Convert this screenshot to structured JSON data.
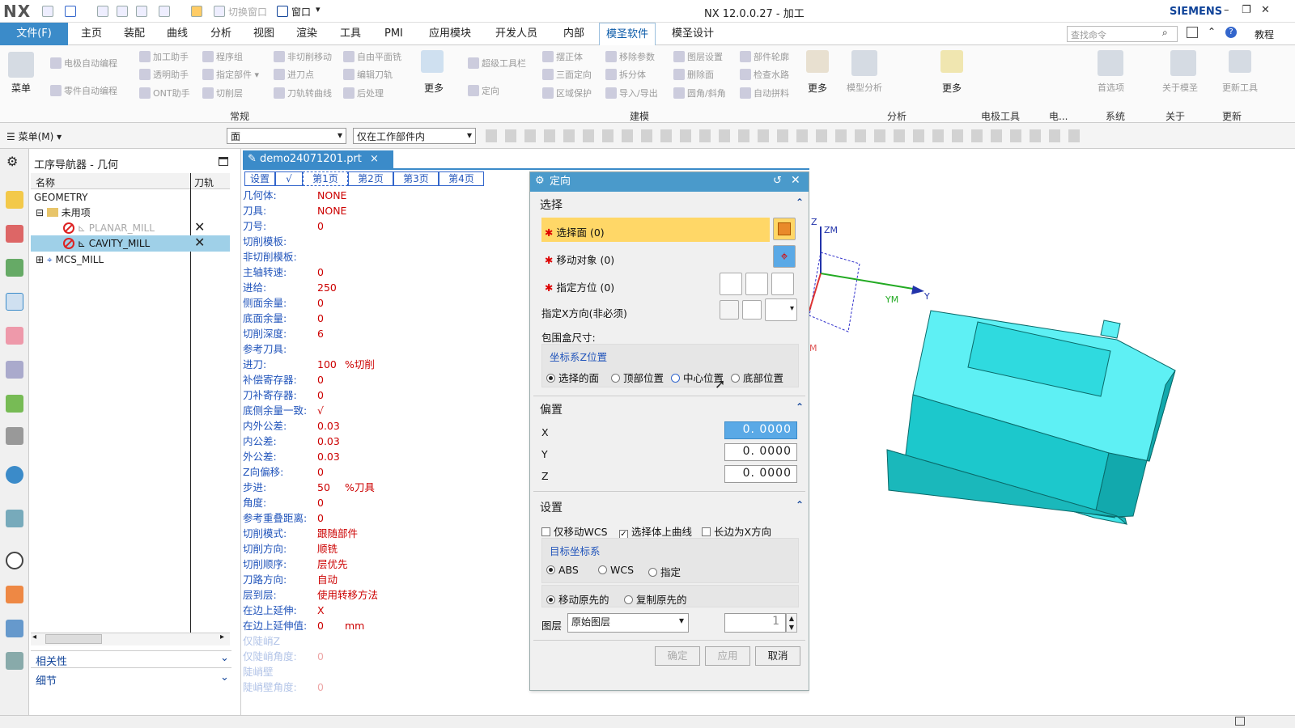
{
  "app": {
    "logo": "NX",
    "title": "NX 12.0.0.27 - 加工",
    "brand": "SIEMENS",
    "brand_color": "#1a4f9a",
    "accent": "#3b8bc9"
  },
  "quickaccess": {
    "switch_window": "切换窗口",
    "window": "窗口"
  },
  "menu": {
    "file": "文件(F)",
    "tabs": [
      "主页",
      "装配",
      "曲线",
      "分析",
      "视图",
      "渲染",
      "工具",
      "PMI",
      "应用模块",
      "开发人员",
      "内部",
      "模圣软件",
      "模圣设计"
    ],
    "active_tab": "模圣软件",
    "search_placeholder": "查找命令",
    "help": "教程"
  },
  "ribbon": {
    "menu_label": "菜单",
    "col1": [
      "电极自动编程",
      "零件自动编程"
    ],
    "col2": [
      "加工助手",
      "透明助手",
      "ONT助手"
    ],
    "col3": [
      "程序组",
      "指定部件",
      "切削层"
    ],
    "col4": [
      "非切削移动",
      "进刀点",
      "刀轨转曲线"
    ],
    "col5": [
      "自由平面铣",
      "编辑刀轨",
      "后处理"
    ],
    "more1": "更多",
    "col6": [
      "超级工具栏",
      "定向"
    ],
    "col7": [
      "摆正体",
      "三面定向",
      "区域保护"
    ],
    "col8": [
      "移除参数",
      "拆分体",
      "导入/导出"
    ],
    "col9": [
      "图层设置",
      "删除面",
      "圆角/斜角"
    ],
    "col10": [
      "部件轮廓",
      "检查水路",
      "自动拼料"
    ],
    "more2": "更多",
    "model_analysis": "模型分析",
    "more3": "更多",
    "prefs": "首选项",
    "about": "关于模圣",
    "update": "更新工具",
    "groups": [
      "常规",
      "建模",
      "分析",
      "电极工具",
      "电...",
      "系统",
      "关于",
      "更新"
    ]
  },
  "toolbar2": {
    "menu": "菜单(M)",
    "filter": "面",
    "scope": "仅在工作部件内"
  },
  "navigator": {
    "title": "工序导航器 - 几何",
    "col_name": "名称",
    "col_path": "刀轨",
    "rows": [
      {
        "name": "GEOMETRY"
      },
      {
        "name": "未用项"
      },
      {
        "name": "PLANAR_MILL"
      },
      {
        "name": "CAVITY_MILL"
      },
      {
        "name": "MCS_MILL"
      }
    ],
    "path_mark": "✕",
    "relations": "相关性",
    "details": "细节"
  },
  "document": {
    "tab": "demo24071201.prt",
    "close": "×"
  },
  "info": {
    "tabs": [
      "设置",
      "√",
      "第1页",
      "第2页",
      "第3页",
      "第4页"
    ],
    "rows": [
      {
        "label": "几何体:",
        "value": "NONE",
        "unit": ""
      },
      {
        "label": "刀具:",
        "value": "NONE",
        "unit": ""
      },
      {
        "label": "刀号:",
        "value": "0",
        "unit": ""
      },
      {
        "label": "切削模板:",
        "value": "",
        "unit": ""
      },
      {
        "label": "非切削模板:",
        "value": "",
        "unit": ""
      },
      {
        "label": "主轴转速:",
        "value": "0",
        "unit": ""
      },
      {
        "label": "进给:",
        "value": "250",
        "unit": ""
      },
      {
        "label": "侧面余量:",
        "value": "0",
        "unit": ""
      },
      {
        "label": "底面余量:",
        "value": "0",
        "unit": ""
      },
      {
        "label": "切削深度:",
        "value": "6",
        "unit": ""
      },
      {
        "label": "参考刀具:",
        "value": "",
        "unit": ""
      },
      {
        "label": "进刀:",
        "value": "100",
        "unit": "%切削"
      },
      {
        "label": "补偿寄存器:",
        "value": "0",
        "unit": ""
      },
      {
        "label": "刀补寄存器:",
        "value": "0",
        "unit": ""
      },
      {
        "label": "底侧余量一致:",
        "value": "√",
        "unit": ""
      },
      {
        "label": "内外公差:",
        "value": "0.03",
        "unit": ""
      },
      {
        "label": "内公差:",
        "value": "0.03",
        "unit": ""
      },
      {
        "label": "外公差:",
        "value": "0.03",
        "unit": ""
      },
      {
        "label": "Z向偏移:",
        "value": "0",
        "unit": ""
      },
      {
        "label": "步进:",
        "value": "50",
        "unit": "%刀具"
      },
      {
        "label": "角度:",
        "value": "0",
        "unit": ""
      },
      {
        "label": "参考重叠距离:",
        "value": "0",
        "unit": ""
      },
      {
        "label": "切削模式:",
        "value": "跟随部件",
        "unit": ""
      },
      {
        "label": "切削方向:",
        "value": "顺铣",
        "unit": ""
      },
      {
        "label": "切削顺序:",
        "value": "层优先",
        "unit": ""
      },
      {
        "label": "刀路方向:",
        "value": "自动",
        "unit": ""
      },
      {
        "label": "层到层:",
        "value": "使用转移方法",
        "unit": ""
      },
      {
        "label": "在边上延伸:",
        "value": "X",
        "unit": ""
      },
      {
        "label": "在边上延伸值:",
        "value": "0",
        "unit": "mm"
      },
      {
        "label": "仅陡峭Z",
        "value": "",
        "unit": ""
      },
      {
        "label": "仅陡峭角度:",
        "value": "0",
        "unit": ""
      },
      {
        "label": "陡峭壁",
        "value": "",
        "unit": ""
      },
      {
        "label": "陡峭壁角度:",
        "value": "0",
        "unit": ""
      }
    ]
  },
  "dialog": {
    "title": "定向",
    "sec_select": "选择",
    "select_face": "选择面 (0)",
    "move_object": "移动对象 (0)",
    "specify_orient": "指定方位 (0)",
    "specify_x": "指定X方向(非必须)",
    "bbox": "包围盒尺寸:",
    "zpos_group": "坐标系Z位置",
    "zpos_options": [
      "选择的面",
      "顶部位置",
      "中心位置",
      "底部位置"
    ],
    "sec_offset": "偏置",
    "x_label": "X",
    "y_label": "Y",
    "z_label": "Z",
    "x": "0. 0000",
    "y": "0. 0000",
    "z": "0. 0000",
    "sec_settings": "设置",
    "only_wcs": "仅移动WCS",
    "select_curves": "选择体上曲线",
    "long_edge": "长边为X方向",
    "target_group": "目标坐标系",
    "target_options": [
      "ABS",
      "WCS",
      "指定"
    ],
    "move_options": [
      "移动原先的",
      "复制原先的"
    ],
    "layer_label": "图层",
    "layer_value": "原始图层",
    "layer_num": "1",
    "ok": "确定",
    "apply": "应用",
    "cancel": "取消"
  },
  "viewport": {
    "axis_z": "Z",
    "axis_zm": "ZM",
    "axis_ym": "YM",
    "axis_y": "Y",
    "axis_m": "M",
    "part_color": "#2fe6ee"
  }
}
